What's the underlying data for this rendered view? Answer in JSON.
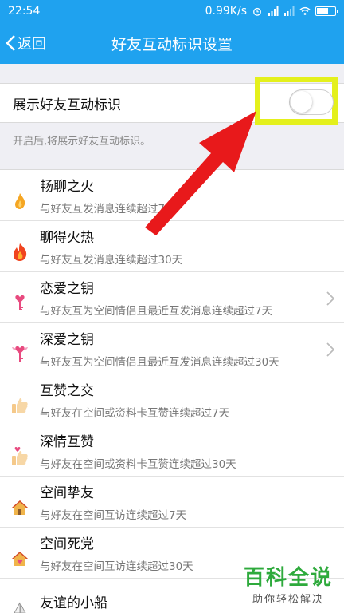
{
  "status_bar": {
    "time": "22:54",
    "speed": "0.99K/s"
  },
  "title_bar": {
    "back_label": "返回",
    "title": "好友互动标识设置"
  },
  "toggle": {
    "label": "展示好友互动标识",
    "enabled": false,
    "hint": "开启后,将展示好友互动标识。"
  },
  "items": [
    {
      "name": "畅聊之火",
      "desc": "与好友互发消息连续超过7天",
      "icon": "flame-icon",
      "chevron": false
    },
    {
      "name": "聊得火热",
      "desc": "与好友互发消息连续超过30天",
      "icon": "big-flame-icon",
      "chevron": false
    },
    {
      "name": "恋爱之钥",
      "desc": "与好友互为空间情侣且最近互发消息连续超过7天",
      "icon": "heart-key-icon",
      "chevron": true
    },
    {
      "name": "深爱之钥",
      "desc": "与好友互为空间情侣且最近互发消息连续超过30天",
      "icon": "winged-heart-key-icon",
      "chevron": true
    },
    {
      "name": "互赞之交",
      "desc": "与好友在空间或资料卡互赞连续超过7天",
      "icon": "thumbs-up-icon",
      "chevron": false
    },
    {
      "name": "深情互赞",
      "desc": "与好友在空间或资料卡互赞连续超过30天",
      "icon": "heart-thumbs-up-icon",
      "chevron": false
    },
    {
      "name": "空间挚友",
      "desc": "与好友在空间互访连续超过7天",
      "icon": "house-icon",
      "chevron": false
    },
    {
      "name": "空间死党",
      "desc": "与好友在空间互访连续超过30天",
      "icon": "house-heart-icon",
      "chevron": false
    },
    {
      "name": "友谊的小船",
      "desc": "",
      "icon": "boat-icon",
      "chevron": false
    }
  ],
  "watermark": {
    "title": "百科全说",
    "subtitle": "助你轻松解决"
  },
  "colors": {
    "accent": "#1fa2ef",
    "highlight": "#e4f01c",
    "arrow": "#e8191b"
  }
}
